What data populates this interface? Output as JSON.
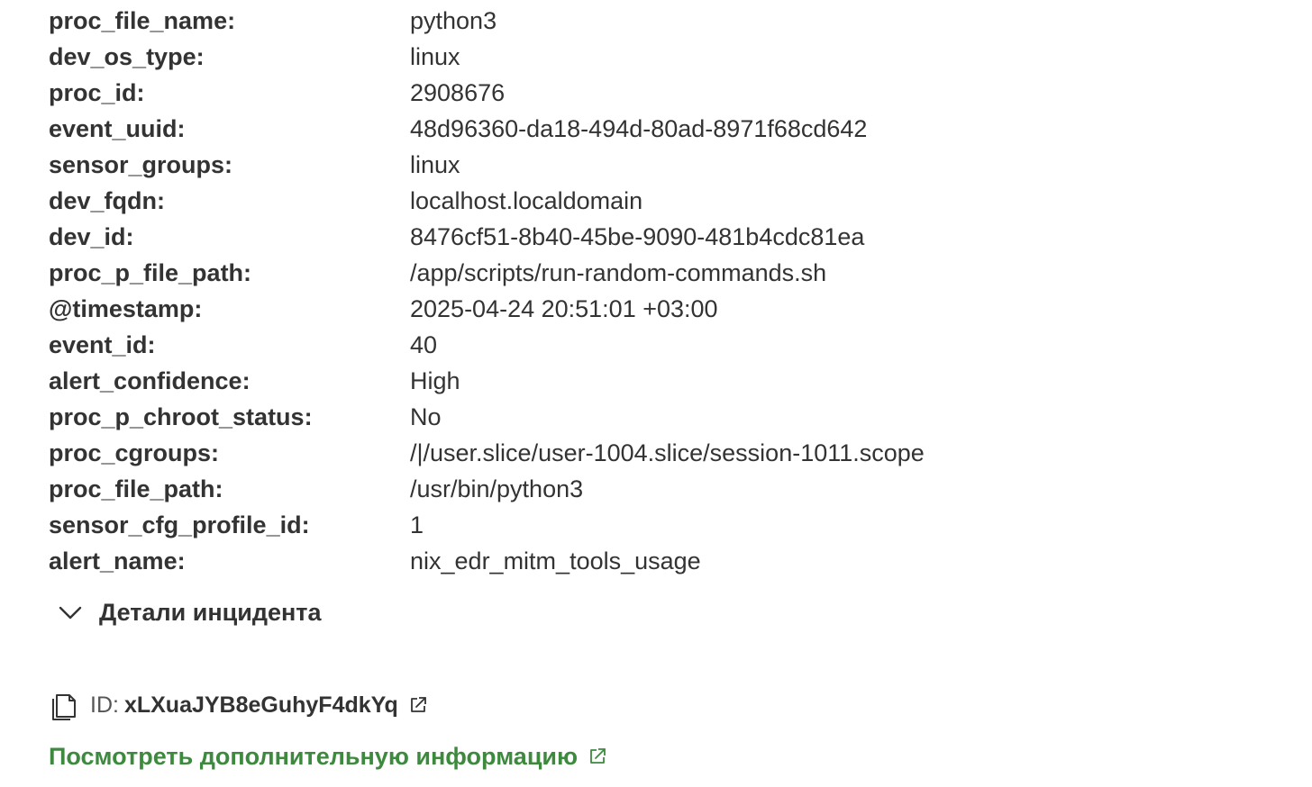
{
  "fields": [
    {
      "key": "proc_file_name:",
      "value": "python3"
    },
    {
      "key": "dev_os_type:",
      "value": "linux"
    },
    {
      "key": "proc_id:",
      "value": "2908676"
    },
    {
      "key": "event_uuid:",
      "value": "48d96360-da18-494d-80ad-8971f68cd642"
    },
    {
      "key": "sensor_groups:",
      "value": "linux"
    },
    {
      "key": "dev_fqdn:",
      "value": "localhost.localdomain"
    },
    {
      "key": "dev_id:",
      "value": "8476cf51-8b40-45be-9090-481b4cdc81ea"
    },
    {
      "key": "proc_p_file_path:",
      "value": "/app/scripts/run-random-commands.sh"
    },
    {
      "key": "@timestamp:",
      "value": "2025-04-24 20:51:01 +03:00"
    },
    {
      "key": "event_id:",
      "value": "40"
    },
    {
      "key": "alert_confidence:",
      "value": "High"
    },
    {
      "key": "proc_p_chroot_status:",
      "value": "No"
    },
    {
      "key": "proc_cgroups:",
      "value": "/|/user.slice/user-1004.slice/session-1011.scope"
    },
    {
      "key": "proc_file_path:",
      "value": "/usr/bin/python3"
    },
    {
      "key": "sensor_cfg_profile_id:",
      "value": "1"
    },
    {
      "key": "alert_name:",
      "value": "nix_edr_mitm_tools_usage"
    }
  ],
  "details": {
    "label": "Детали инцидента",
    "icon": "chevron-down-icon"
  },
  "id_row": {
    "prefix": "ID:",
    "value": "xLXuaJYB8eGuhyF4dkYq",
    "copy_icon": "copy-icon",
    "link_icon": "external-link-icon"
  },
  "more_link": {
    "label": "Посмотреть дополнительную информацию",
    "icon": "external-link-icon"
  },
  "colors": {
    "text": "#333333",
    "link_green": "#3d8a3e",
    "muted": "#555555"
  }
}
